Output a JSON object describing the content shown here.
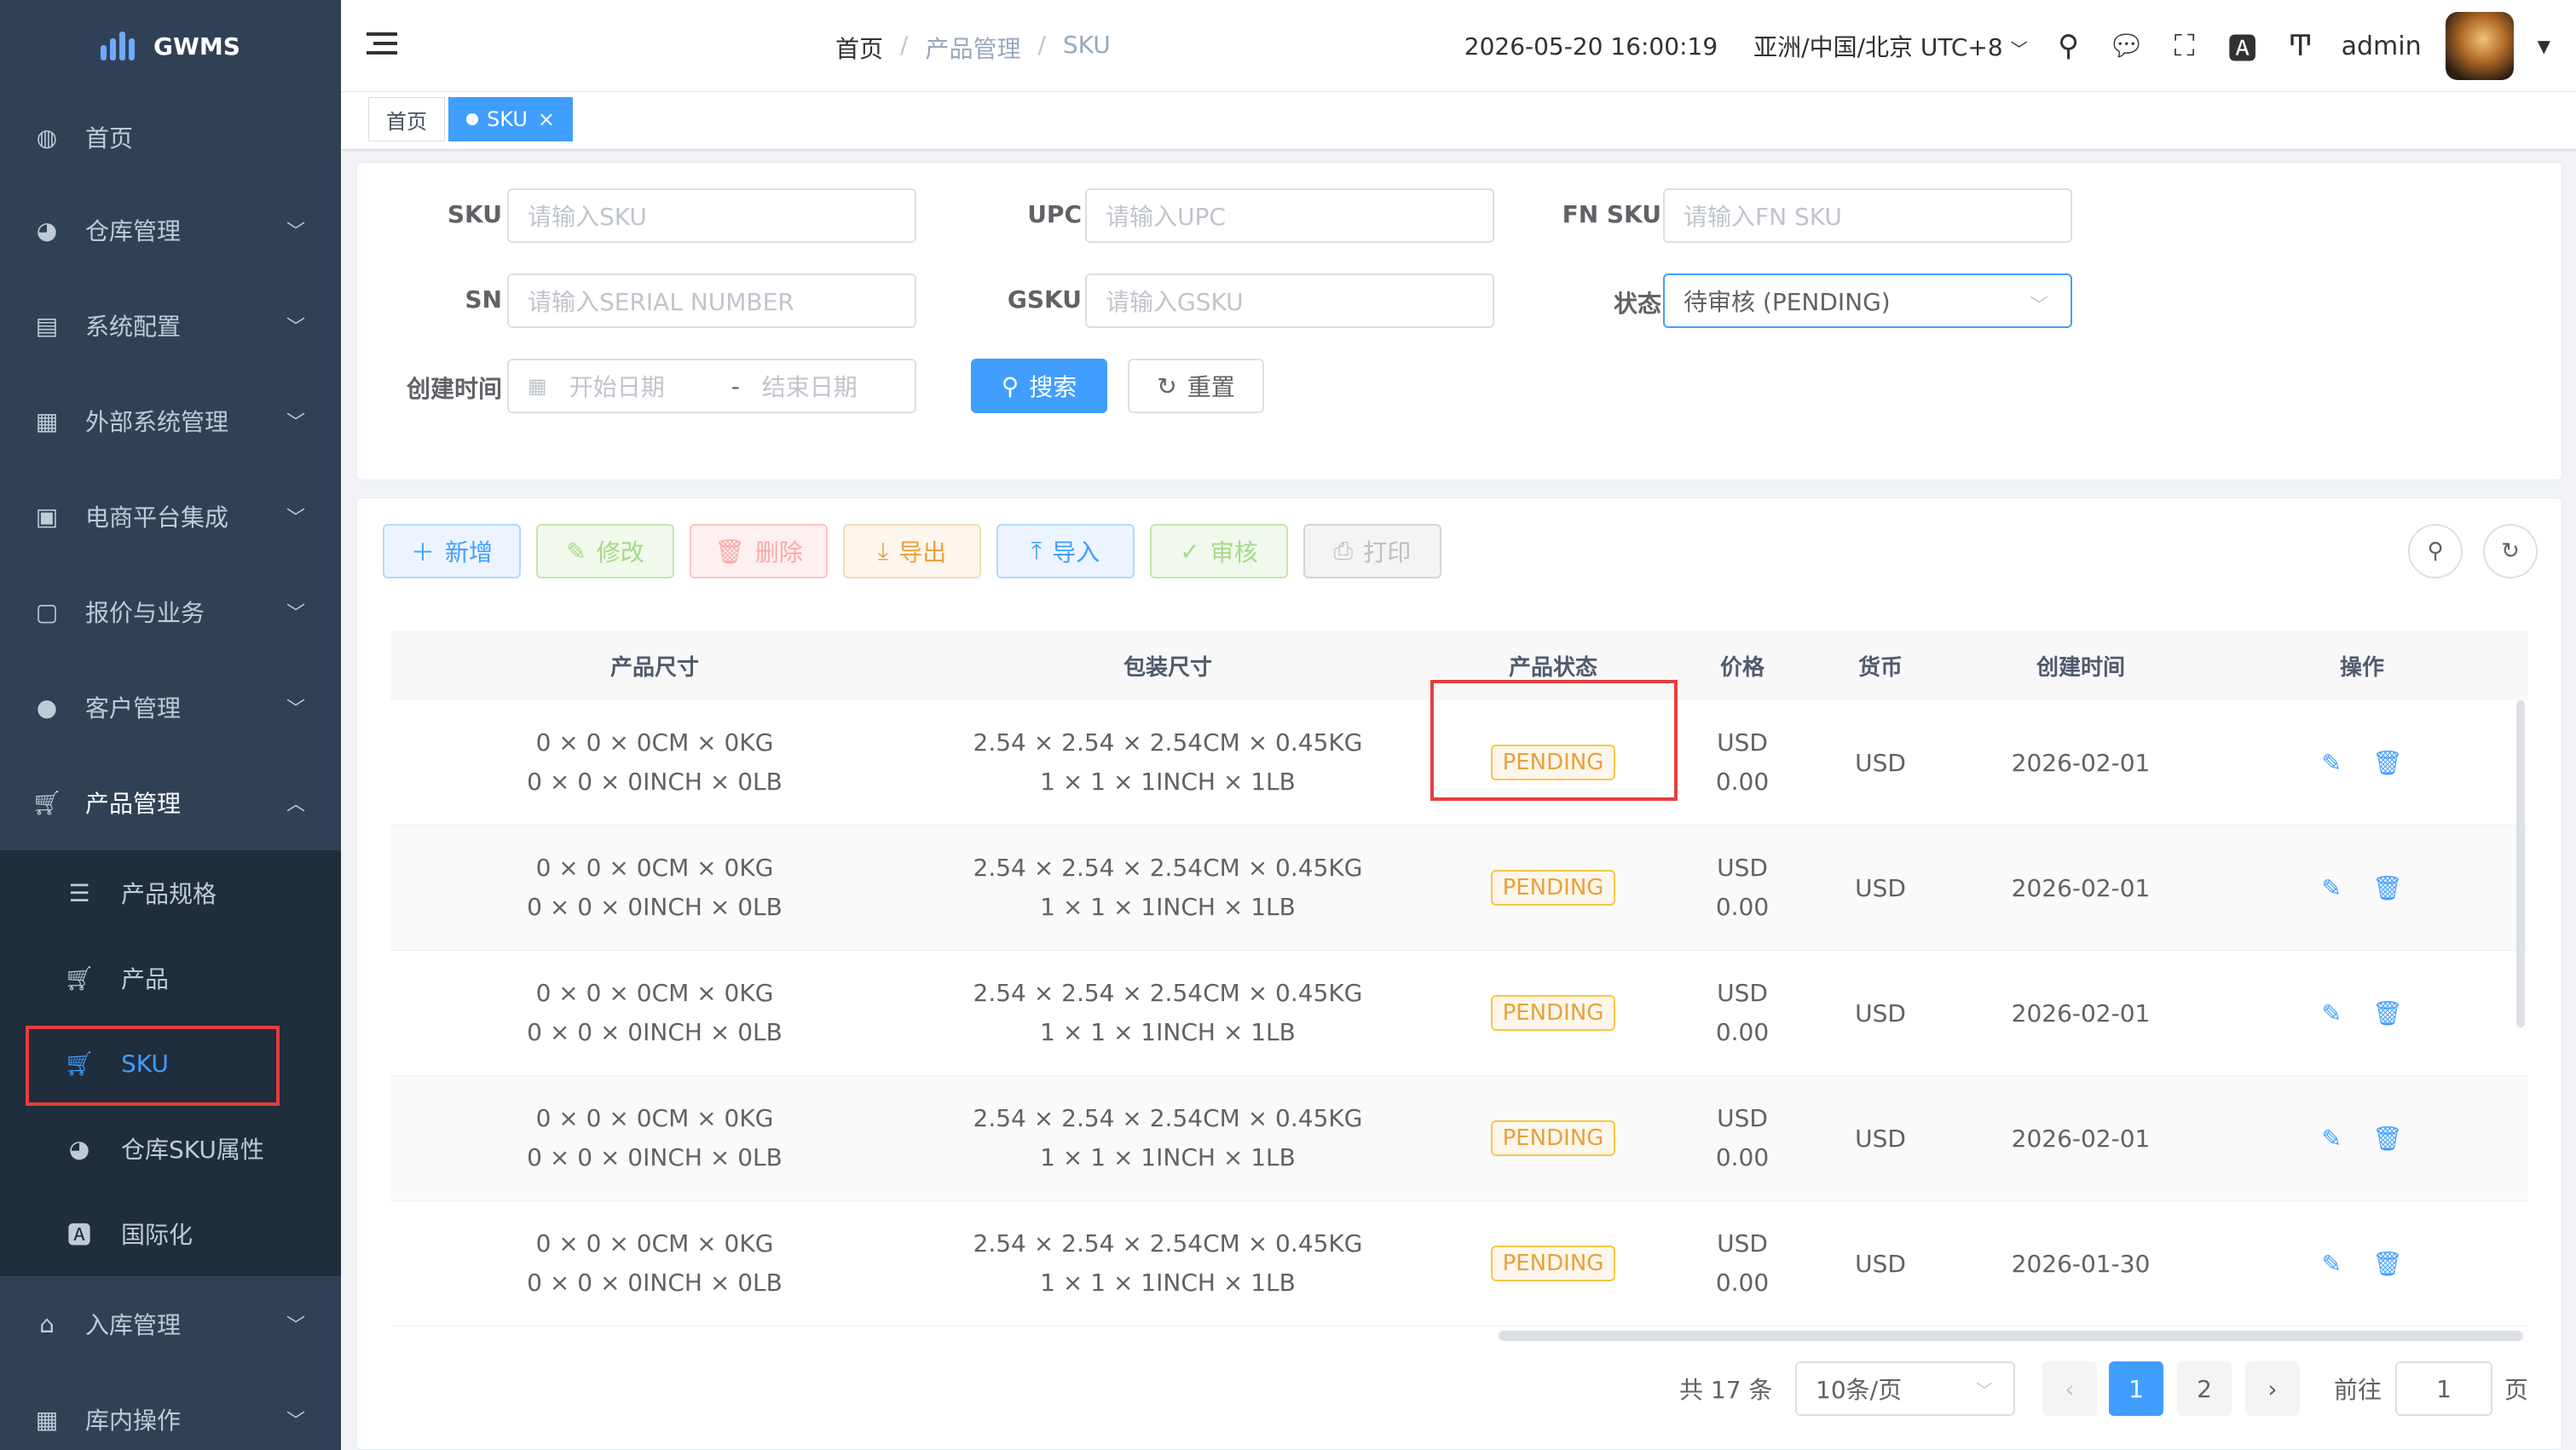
{
  "app": {
    "title": "GWMS"
  },
  "sidebar": {
    "items": [
      {
        "label": "首页",
        "icon": "dashboard-icon"
      },
      {
        "label": "仓库管理",
        "icon": "globe-icon"
      },
      {
        "label": "系统配置",
        "icon": "server-icon"
      },
      {
        "label": "外部系统管理",
        "icon": "grid-icon"
      },
      {
        "label": "电商平台集成",
        "icon": "shop-icon"
      },
      {
        "label": "报价与业务",
        "icon": "receipt-icon"
      },
      {
        "label": "客户管理",
        "icon": "user-icon"
      },
      {
        "label": "产品管理",
        "icon": "cart-icon"
      }
    ],
    "sub_items": [
      {
        "label": "产品规格",
        "icon": "list-icon"
      },
      {
        "label": "产品",
        "icon": "cart-icon"
      },
      {
        "label": "SKU",
        "icon": "cart-icon"
      },
      {
        "label": "仓库SKU属性",
        "icon": "globe-icon"
      },
      {
        "label": "国际化",
        "icon": "translate-icon"
      }
    ],
    "bottom_items": [
      {
        "label": "入库管理",
        "icon": "home-icon"
      },
      {
        "label": "库内操作",
        "icon": "table-icon"
      }
    ]
  },
  "navbar": {
    "breadcrumb": [
      "首页",
      "产品管理",
      "SKU"
    ],
    "datetime": "2026-05-20 16:00:19",
    "timezone": "亚洲/中国/北京 UTC+8",
    "user": "admin"
  },
  "tags": [
    {
      "label": "首页"
    },
    {
      "label": "SKU"
    }
  ],
  "search": {
    "sku_label": "SKU",
    "sku_placeholder": "请输入SKU",
    "upc_label": "UPC",
    "upc_placeholder": "请输入UPC",
    "fnsku_label": "FN SKU",
    "fnsku_placeholder": "请输入FN SKU",
    "sn_label": "SN",
    "sn_placeholder": "请输入SERIAL NUMBER",
    "gsku_label": "GSKU",
    "gsku_placeholder": "请输入GSKU",
    "status_label": "状态",
    "status_value": "待审核 (PENDING)",
    "created_label": "创建时间",
    "start_placeholder": "开始日期",
    "date_sep": "-",
    "end_placeholder": "结束日期",
    "search_btn": "搜索",
    "reset_btn": "重置"
  },
  "toolbar": {
    "add": "新增",
    "edit": "修改",
    "delete": "删除",
    "export": "导出",
    "import": "导入",
    "audit": "审核",
    "print": "打印"
  },
  "table": {
    "headers": [
      "产品尺寸",
      "包装尺寸",
      "产品状态",
      "价格",
      "货币",
      "创建时间",
      "操作"
    ],
    "rows": [
      {
        "size1": "0 × 0 × 0CM × 0KG",
        "size2": "0 × 0 × 0INCH × 0LB",
        "pack1": "2.54 × 2.54 × 2.54CM × 0.45KG",
        "pack2": "1 × 1 × 1INCH × 1LB",
        "status": "PENDING",
        "price1": "USD",
        "price2": "0.00",
        "currency": "USD",
        "created": "2026-02-01"
      },
      {
        "size1": "0 × 0 × 0CM × 0KG",
        "size2": "0 × 0 × 0INCH × 0LB",
        "pack1": "2.54 × 2.54 × 2.54CM × 0.45KG",
        "pack2": "1 × 1 × 1INCH × 1LB",
        "status": "PENDING",
        "price1": "USD",
        "price2": "0.00",
        "currency": "USD",
        "created": "2026-02-01"
      },
      {
        "size1": "0 × 0 × 0CM × 0KG",
        "size2": "0 × 0 × 0INCH × 0LB",
        "pack1": "2.54 × 2.54 × 2.54CM × 0.45KG",
        "pack2": "1 × 1 × 1INCH × 1LB",
        "status": "PENDING",
        "price1": "USD",
        "price2": "0.00",
        "currency": "USD",
        "created": "2026-02-01"
      },
      {
        "size1": "0 × 0 × 0CM × 0KG",
        "size2": "0 × 0 × 0INCH × 0LB",
        "pack1": "2.54 × 2.54 × 2.54CM × 0.45KG",
        "pack2": "1 × 1 × 1INCH × 1LB",
        "status": "PENDING",
        "price1": "USD",
        "price2": "0.00",
        "currency": "USD",
        "created": "2026-02-01"
      },
      {
        "size1": "0 × 0 × 0CM × 0KG",
        "size2": "0 × 0 × 0INCH × 0LB",
        "pack1": "2.54 × 2.54 × 2.54CM × 0.45KG",
        "pack2": "1 × 1 × 1INCH × 1LB",
        "status": "PENDING",
        "price1": "USD",
        "price2": "0.00",
        "currency": "USD",
        "created": "2026-01-30"
      }
    ]
  },
  "pagination": {
    "total": "共 17 条",
    "page_size": "10条/页",
    "pages": [
      "1",
      "2"
    ],
    "goto_label": "前往",
    "goto_value": "1",
    "page_suffix": "页"
  },
  "colors": {
    "sidebar_bg": "#304156",
    "primary": "#409eff",
    "warning": "#e6a23c",
    "highlight": "#e53e3e"
  }
}
